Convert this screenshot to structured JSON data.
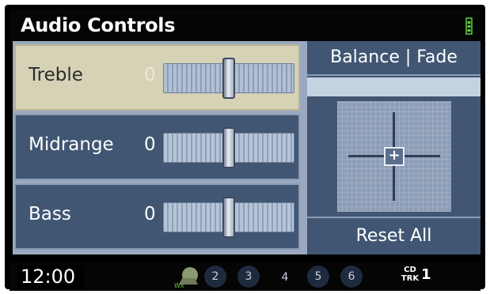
{
  "header": {
    "title": "Audio Controls",
    "signal_icon": "battery-signal-icon"
  },
  "controls": [
    {
      "label": "Treble",
      "value": "0",
      "level": 0.5,
      "selected": true
    },
    {
      "label": "Midrange",
      "value": "0",
      "level": 0.5,
      "selected": false
    },
    {
      "label": "Bass",
      "value": "0",
      "level": 0.5,
      "selected": false
    }
  ],
  "balance_fade": {
    "title": "Balance | Fade",
    "center_glyph": "+"
  },
  "reset": {
    "label": "Reset All"
  },
  "status": {
    "clock": "12:00",
    "presets": [
      "2",
      "3",
      "4",
      "5",
      "6"
    ],
    "source_top": "CD",
    "source_bottom": "TRK",
    "track": "1"
  },
  "colors": {
    "panel": "#405673",
    "selected": "#d6d2b6",
    "accent_green": "#5fd13a"
  }
}
